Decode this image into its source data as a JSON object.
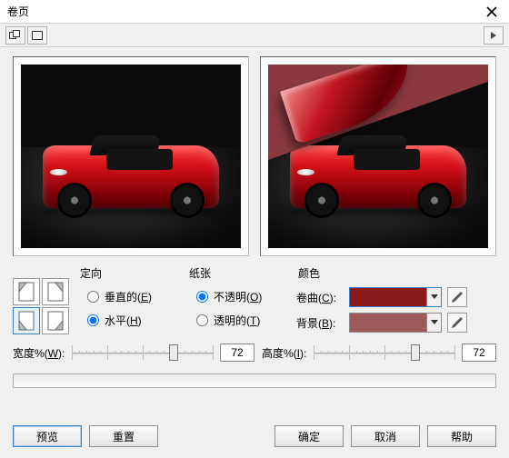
{
  "window": {
    "title": "卷页"
  },
  "toolbar": {
    "icon1_name": "dual-preview-icon",
    "icon2_name": "single-preview-icon",
    "icon_play_name": "play-icon"
  },
  "orientation": {
    "group_label": "定向",
    "vertical_label": "垂直的(E)",
    "horizontal_label": "水平(H)",
    "value": "horizontal"
  },
  "paper": {
    "group_label": "纸张",
    "opaque_label": "不透明(O)",
    "transparent_label": "透明的(T)",
    "value": "opaque"
  },
  "color": {
    "group_label": "颜色",
    "curl_label": "卷曲(C):",
    "bg_label": "背景(B):",
    "curl_hex": "#8d1a1a",
    "bg_hex": "#9e5a5a"
  },
  "sliders": {
    "width_label": "宽度%(W):",
    "width_value": "72",
    "height_label": "高度%(I):",
    "height_value": "72"
  },
  "buttons": {
    "preview": "预览",
    "reset": "重置",
    "ok": "确定",
    "cancel": "取消",
    "help": "帮助"
  },
  "corners": {
    "selected": "top-left"
  }
}
